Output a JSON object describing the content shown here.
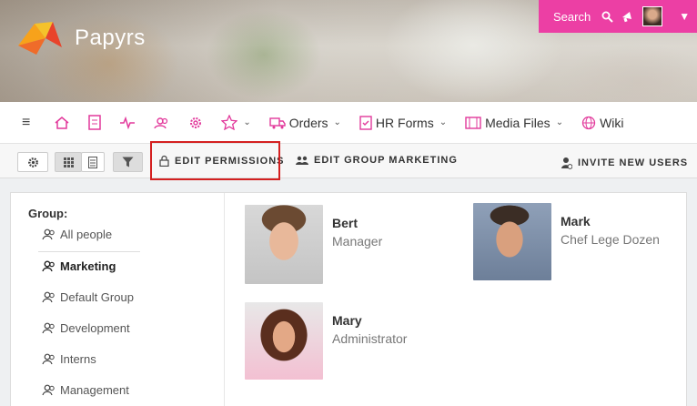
{
  "app": {
    "name": "Papyrs"
  },
  "header": {
    "search_label": "Search",
    "brand_color": "#ec3fa4"
  },
  "nav": {
    "orders": "Orders",
    "hr_forms": "HR Forms",
    "media_files": "Media Files",
    "wiki": "Wiki"
  },
  "toolbar": {
    "edit_permissions": "EDIT PERMISSIONS",
    "edit_group": "EDIT GROUP MARKETING",
    "invite": "INVITE NEW USERS"
  },
  "groups": {
    "title": "Group:",
    "items": [
      "All people",
      "Marketing",
      "Default Group",
      "Development",
      "Interns",
      "Management"
    ],
    "active": "Marketing"
  },
  "people": [
    {
      "name": "Bert",
      "role": "Manager"
    },
    {
      "name": "Mark",
      "role": "Chef Lege Dozen"
    },
    {
      "name": "Mary",
      "role": "Administrator"
    }
  ]
}
